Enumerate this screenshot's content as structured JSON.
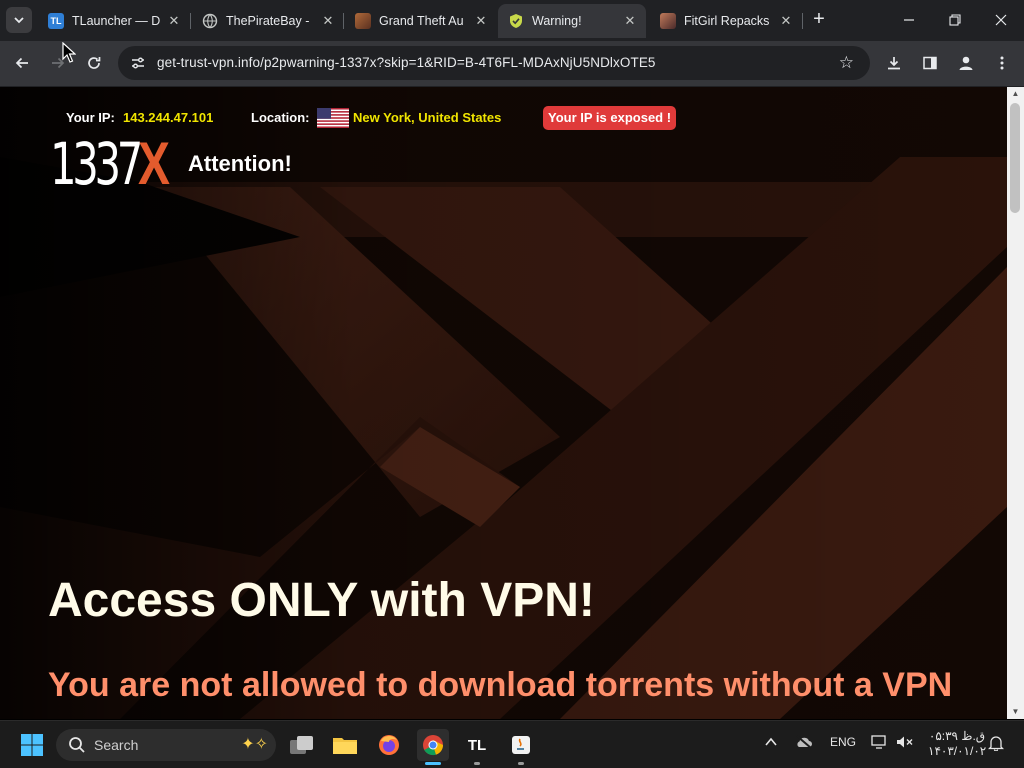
{
  "browser": {
    "tabs": [
      {
        "title": "TLauncher — D",
        "favicon": "tlauncher-icon",
        "active": false
      },
      {
        "title": "ThePirateBay - ",
        "favicon": "globe-icon",
        "active": false
      },
      {
        "title": "Grand Theft Au",
        "favicon": "game-thumbnail-icon",
        "active": false
      },
      {
        "title": "Warning!",
        "favicon": "shield-icon",
        "active": true
      },
      {
        "title": "FitGirl Repacks",
        "favicon": "fitgirl-thumbnail-icon",
        "active": false
      }
    ],
    "url": "get-trust-vpn.info/p2pwarning-1337x?skip=1&RID=B-4T6FL-MDAxNjU5NDlxOTE5"
  },
  "page": {
    "ip_label": "Your IP:",
    "ip_value": "143.244.47.101",
    "location_label": "Location:",
    "location_value": "New York, United States",
    "exposed_badge": "Your IP is exposed !",
    "logo_number": "1337",
    "logo_x": "X",
    "attention": "Attention!",
    "headline": "Access ONLY with VPN!",
    "subline": "You are not allowed to download torrents without a VPN"
  },
  "taskbar": {
    "search_label": "Search",
    "language": "ENG",
    "time": "۰۵:۳۹ ق.ظ",
    "date": "۱۴۰۳/۰۱/۰۲"
  },
  "colors": {
    "accent_yellow": "#f0e400",
    "badge_red": "#e03a3a",
    "logo_orange": "#e35b2d",
    "subline_salmon": "#ff8f6b"
  }
}
